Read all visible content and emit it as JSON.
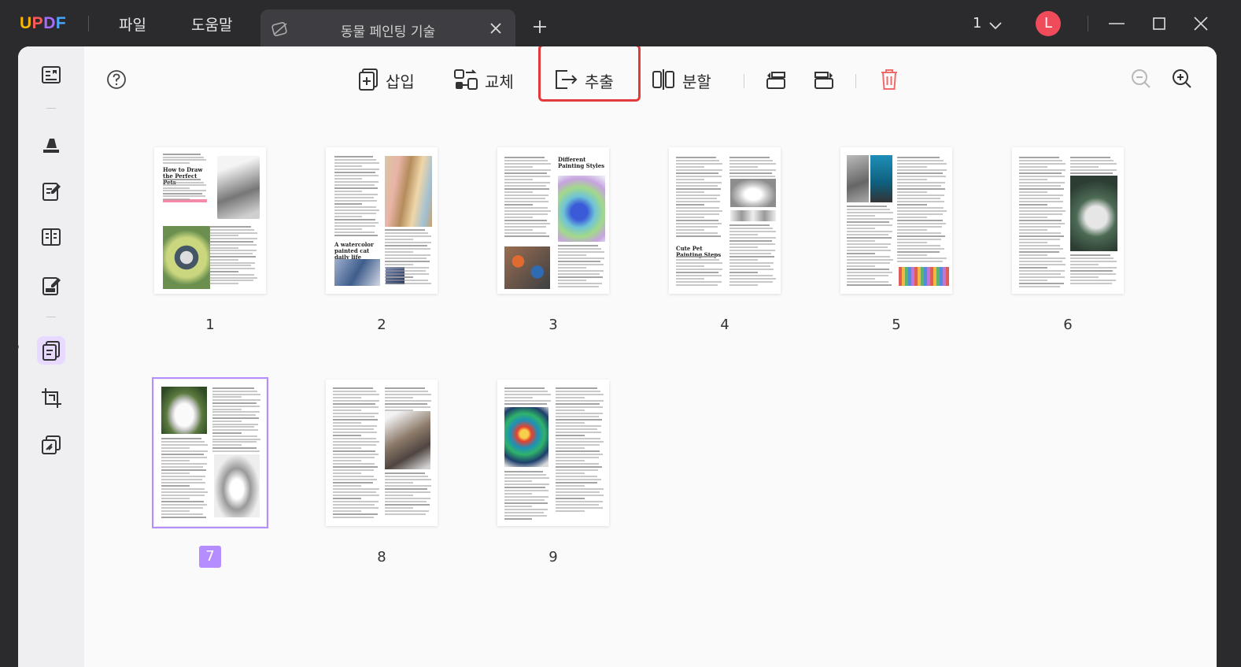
{
  "app": {
    "logo": "UPDF",
    "menu": [
      "파일",
      "도움말"
    ],
    "tab_title": "동물 페인팅 기술",
    "page_count": "1",
    "user_initial": "L"
  },
  "toolbar": {
    "insert": "삽입",
    "replace": "교체",
    "extract": "추출",
    "split": "분할"
  },
  "pages": [
    {
      "number": "1",
      "title": "How to Draw the Perfect Pets",
      "selected": false
    },
    {
      "number": "2",
      "title": "A watercolor painted cat daily life",
      "selected": false
    },
    {
      "number": "3",
      "title": "Different Painting Styles",
      "selected": false
    },
    {
      "number": "4",
      "title": "Cute Pet Painting Steps",
      "selected": false
    },
    {
      "number": "5",
      "title": "",
      "selected": false
    },
    {
      "number": "6",
      "title": "",
      "selected": false
    },
    {
      "number": "7",
      "title": "",
      "selected": true
    },
    {
      "number": "8",
      "title": "",
      "selected": false
    },
    {
      "number": "9",
      "title": "",
      "selected": false
    }
  ],
  "colors": {
    "accent": "#b68dff",
    "highlight_box": "#e23b3b",
    "avatar": "#f04b5a",
    "delete": "#f06a6a"
  }
}
